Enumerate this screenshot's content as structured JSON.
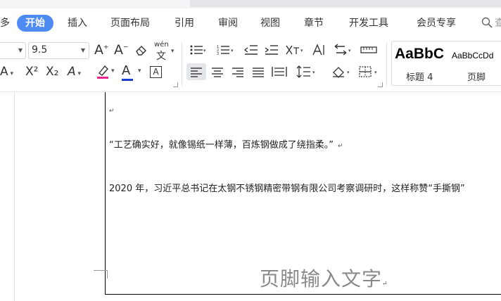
{
  "tabs": {
    "cut_left": "多",
    "items": [
      "开始",
      "插入",
      "页面布局",
      "引用",
      "审阅",
      "视图",
      "章节",
      "开发工具",
      "会员专享"
    ],
    "search_partial": "查"
  },
  "ribbon": {
    "font_size_value": "9.5",
    "grow_font_label": "A",
    "shrink_font_label": "A",
    "clear_format_icon": "eraser-icon",
    "pinyin_label": "wén",
    "superscript_label": "X²",
    "subscript_label": "X₂",
    "font_effect_label": "A",
    "font_color_label": "A",
    "char_border_label": "A",
    "text_effect_label": "A",
    "highlight_color": "#e8258c",
    "font_color": "#1a3fd6",
    "styles": [
      {
        "preview": "AaBbC",
        "name": "标题 4"
      },
      {
        "preview": "AaBbCcDd",
        "name": "页脚"
      }
    ]
  },
  "document": {
    "quote_line": "“工艺确实好，就像锡纸一样薄，百炼钢做成了绕指柔。”",
    "body_line": "2020 年，习近平总书记在太钢不锈钢精密带钢有限公司考察调研时，这样称赞“手撕钢”",
    "footer_placeholder": "页脚输入文字",
    "para_mark": "↵"
  }
}
